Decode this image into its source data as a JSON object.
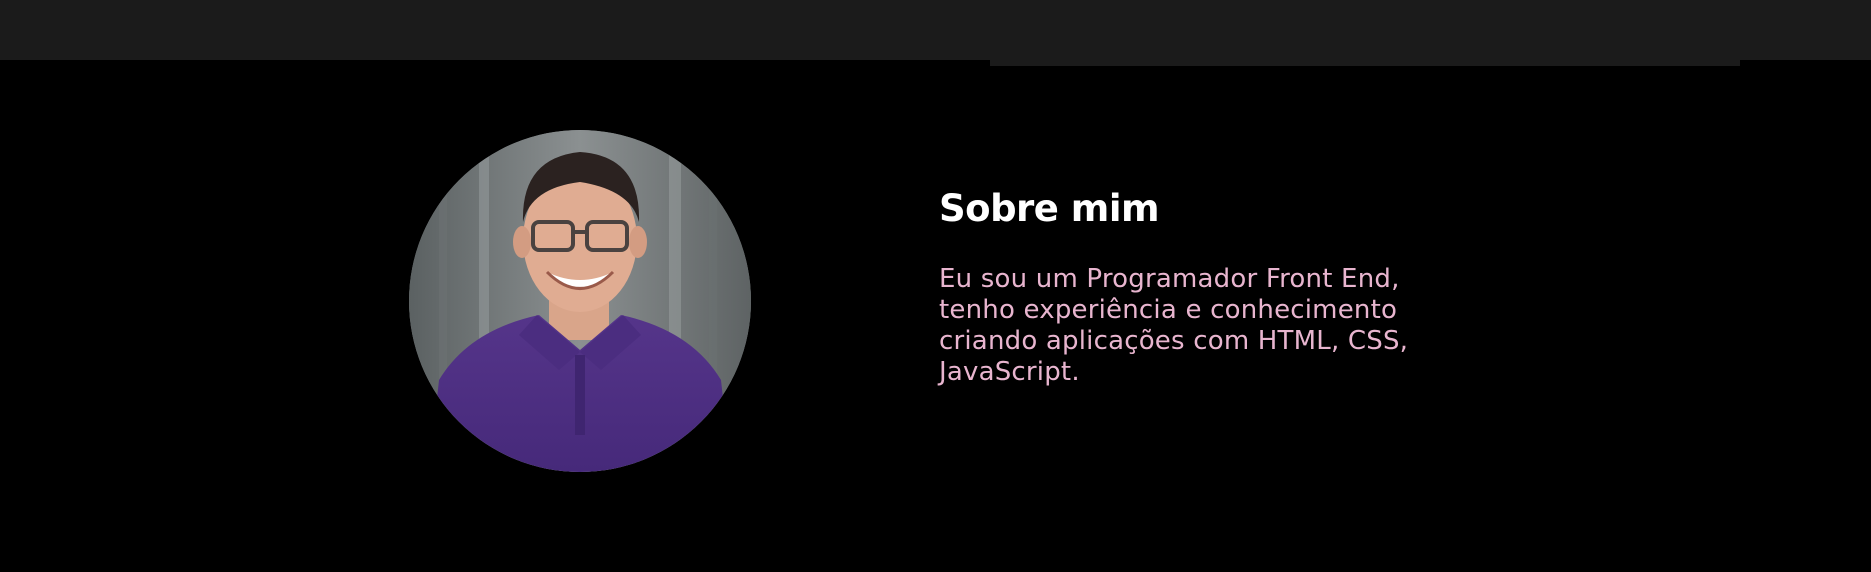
{
  "about": {
    "title": "Sobre mim",
    "description": "Eu sou um Programador Front End, tenho experiência e conhecimento criando aplicações com HTML, CSS, JavaScript."
  },
  "colors": {
    "background": "#000000",
    "topbar": "#1b1b1b",
    "title": "#ffffff",
    "text": "#e8b5cf"
  }
}
